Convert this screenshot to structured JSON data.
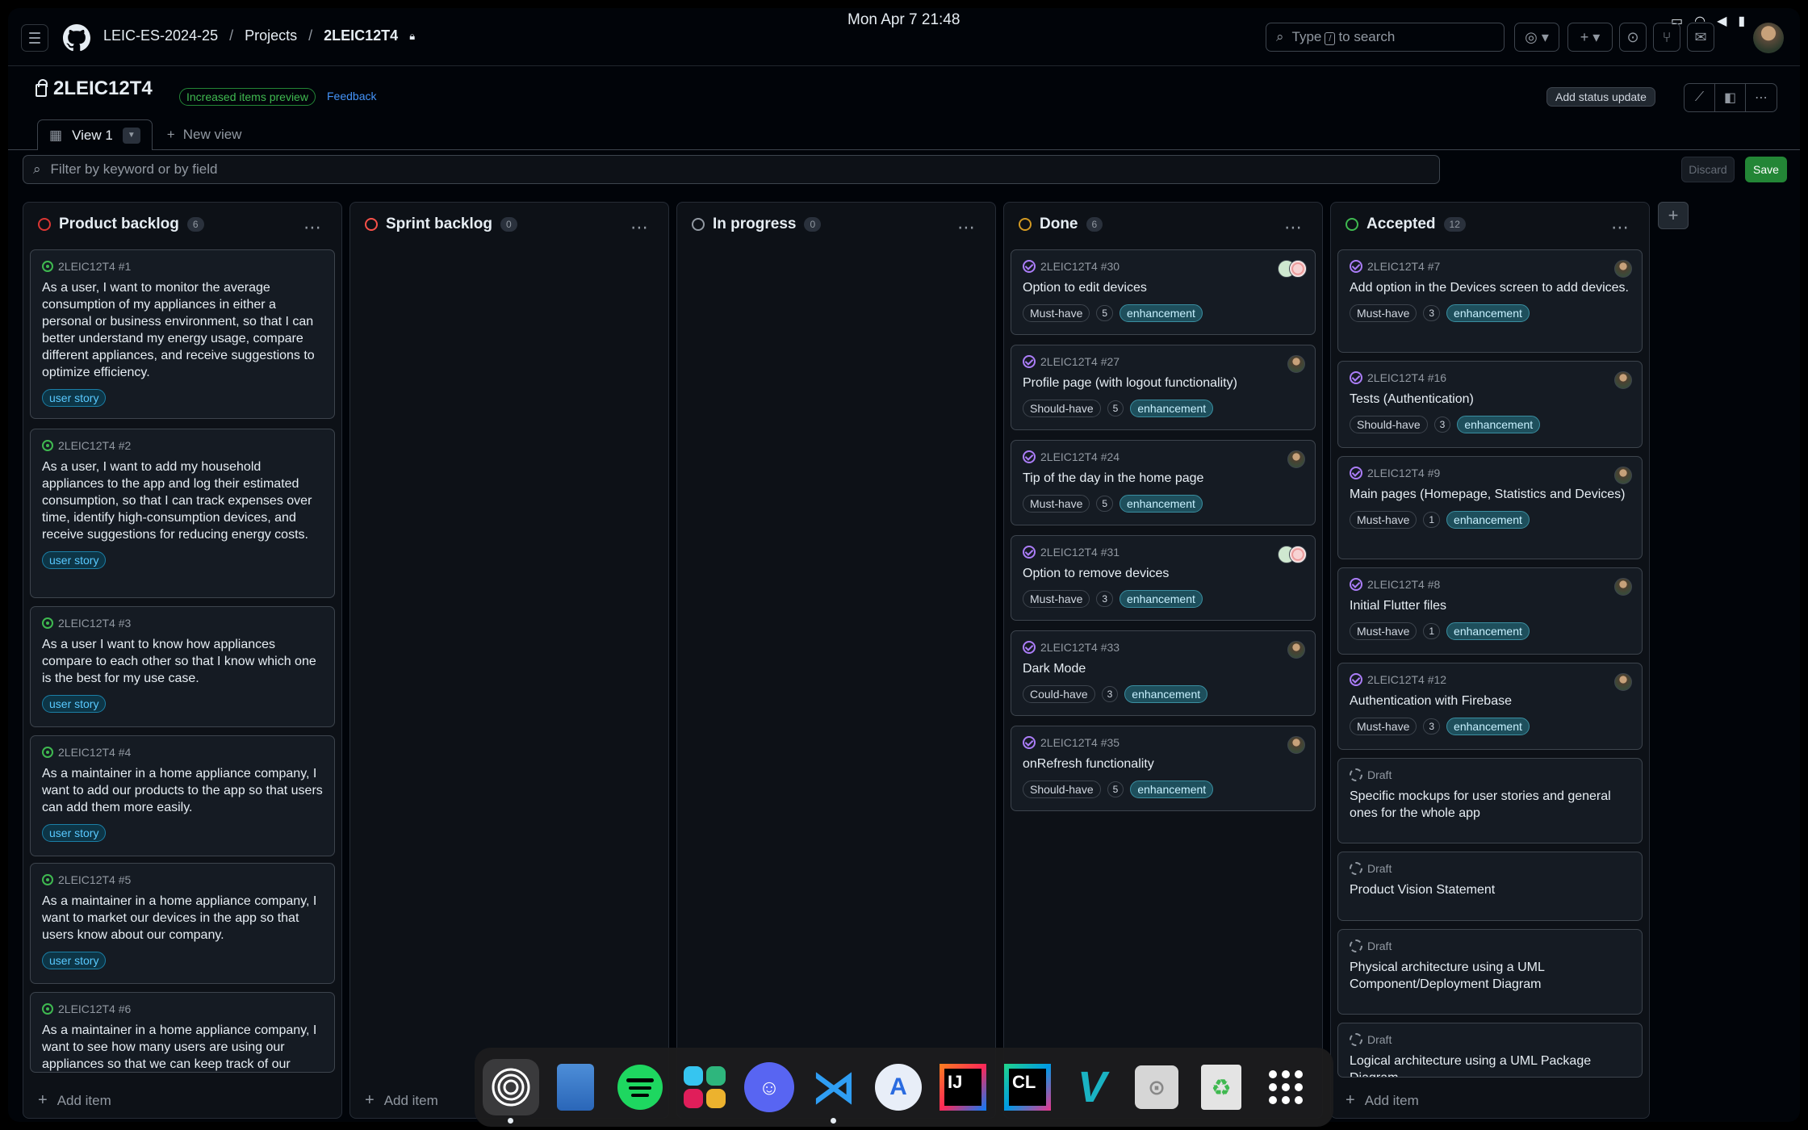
{
  "system": {
    "clock": "Mon Apr 7  21:48"
  },
  "header": {
    "breadcrumb": [
      "LEIC-ES-2024-25",
      "Projects",
      "2LEIC12T4"
    ],
    "breadcrumb_sep": "/",
    "search_placeholder_pre": "Type",
    "search_key": "/",
    "search_placeholder_post": "to search"
  },
  "project": {
    "title": "2LEIC12T4",
    "preview_badge": "Increased items preview",
    "feedback_link": "Feedback",
    "status_update_button": "Add status update"
  },
  "tabs": {
    "view1": "View 1",
    "new_view": "New view"
  },
  "filter": {
    "placeholder": "Filter by keyword or by field",
    "discard": "Discard",
    "save": "Save"
  },
  "colors": {
    "product_backlog": "#da3633",
    "sprint_backlog": "#f85149",
    "in_progress": "#9198a1",
    "done": "#d29922",
    "accepted": "#3fb950"
  },
  "add_item_label": "Add item",
  "columns": {
    "product_backlog": {
      "title": "Product backlog",
      "count": "6",
      "cards": [
        {
          "ref": "2LEIC12T4 #1",
          "title": "As a user, I want to monitor the average consumption of my appliances in either a personal or business environment, so that I can better understand my energy usage, compare different appliances, and receive suggestions to optimize efficiency.",
          "label": "user story"
        },
        {
          "ref": "2LEIC12T4 #2",
          "title": "As a user, I want to add my household appliances to the app and log their estimated consumption, so that I can track expenses over time, identify high-consumption devices, and receive suggestions for reducing energy costs.",
          "label": "user story"
        },
        {
          "ref": "2LEIC12T4 #3",
          "title": "As a user I want to know how appliances compare to each other so that I know which one is the best for my use case.",
          "label": "user story"
        },
        {
          "ref": "2LEIC12T4 #4",
          "title": "As a maintainer in a home appliance company, I want to add our products to the app so that users can add them more easily.",
          "label": "user story"
        },
        {
          "ref": "2LEIC12T4 #5",
          "title": "As a maintainer in a home appliance company, I want to market our devices in the app so that users know about our company.",
          "label": "user story"
        },
        {
          "ref": "2LEIC12T4 #6",
          "title": "As a maintainer in a home appliance company, I want to see how many users are using our appliances so that we can keep track of our",
          "label": ""
        }
      ]
    },
    "sprint_backlog": {
      "title": "Sprint backlog",
      "count": "0"
    },
    "in_progress": {
      "title": "In progress",
      "count": "0"
    },
    "done": {
      "title": "Done",
      "count": "6",
      "cards": [
        {
          "ref": "2LEIC12T4 #30",
          "title": "Option to edit devices",
          "priority": "Must-have",
          "points": "5",
          "label": "enhancement"
        },
        {
          "ref": "2LEIC12T4 #27",
          "title": "Profile page (with logout functionality)",
          "priority": "Should-have",
          "points": "5",
          "label": "enhancement"
        },
        {
          "ref": "2LEIC12T4 #24",
          "title": "Tip of the day in the home page",
          "priority": "Must-have",
          "points": "5",
          "label": "enhancement"
        },
        {
          "ref": "2LEIC12T4 #31",
          "title": "Option to remove devices",
          "priority": "Must-have",
          "points": "3",
          "label": "enhancement"
        },
        {
          "ref": "2LEIC12T4 #33",
          "title": "Dark Mode",
          "priority": "Could-have",
          "points": "3",
          "label": "enhancement"
        },
        {
          "ref": "2LEIC12T4 #35",
          "title": "onRefresh functionality",
          "priority": "Should-have",
          "points": "5",
          "label": "enhancement"
        }
      ]
    },
    "accepted": {
      "title": "Accepted",
      "count": "12",
      "cards": [
        {
          "ref": "2LEIC12T4 #7",
          "title": "Add option in the Devices screen to add devices.",
          "priority": "Must-have",
          "points": "3",
          "label": "enhancement"
        },
        {
          "ref": "2LEIC12T4 #16",
          "title": "Tests (Authentication)",
          "priority": "Should-have",
          "points": "3",
          "label": "enhancement"
        },
        {
          "ref": "2LEIC12T4 #9",
          "title": "Main pages (Homepage, Statistics and Devices)",
          "priority": "Must-have",
          "points": "1",
          "label": "enhancement"
        },
        {
          "ref": "2LEIC12T4 #8",
          "title": "Initial Flutter files",
          "priority": "Must-have",
          "points": "1",
          "label": "enhancement"
        },
        {
          "ref": "2LEIC12T4 #12",
          "title": "Authentication with Firebase",
          "priority": "Must-have",
          "points": "3",
          "label": "enhancement"
        },
        {
          "ref": "Draft",
          "title": "Specific mockups for user stories and general ones for the whole app"
        },
        {
          "ref": "Draft",
          "title": "Product Vision Statement"
        },
        {
          "ref": "Draft",
          "title": "Physical architecture using a UML Component/Deployment Diagram"
        },
        {
          "ref": "Draft",
          "title": "Logical architecture using a UML Package Diagram"
        }
      ]
    }
  },
  "dock": {
    "apps": [
      "Ubuntu Pro",
      "Files",
      "Spotify",
      "Slack",
      "Discord",
      "VS Code",
      "App Center",
      "IntelliJ IDEA",
      "CLion",
      "Visual Paradigm",
      "Disk",
      "Trash",
      "Show Apps"
    ],
    "jetbrains_ij": "IJ",
    "jetbrains_cl": "CL"
  }
}
